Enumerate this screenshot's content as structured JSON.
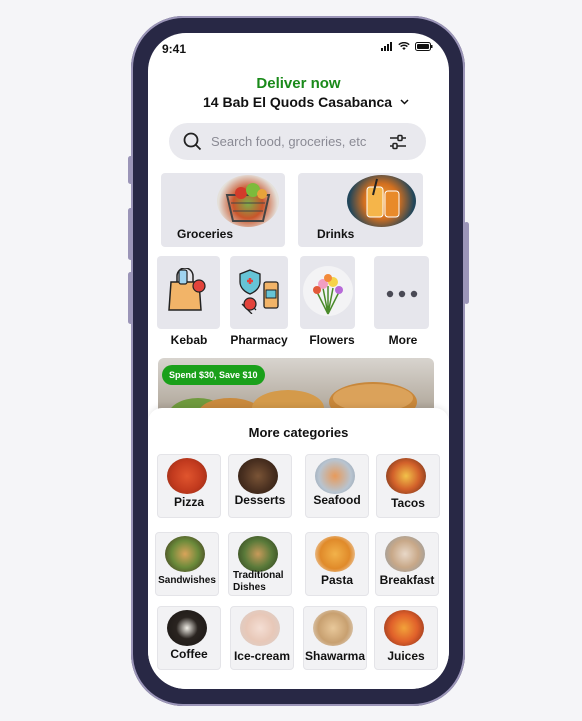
{
  "status": {
    "time": "9:41"
  },
  "header": {
    "deliver_label": "Deliver now",
    "address": "14 Bab El Quods Casabanca"
  },
  "search": {
    "placeholder": "Search food, groceries, etc"
  },
  "featured": [
    {
      "label": "Groceries",
      "icon": "grocery-basket"
    },
    {
      "label": "Drinks",
      "icon": "drinks"
    }
  ],
  "shortcuts": [
    {
      "label": "Kebab",
      "icon": "shopping-bag-icon"
    },
    {
      "label": "Pharmacy",
      "icon": "pharmacy-icon"
    },
    {
      "label": "Flowers",
      "icon": "flowers-icon"
    },
    {
      "label": "More",
      "icon": "more-dots-icon"
    }
  ],
  "promo": {
    "badge": "Spend $30, Save $10"
  },
  "more_categories": {
    "title": "More categories",
    "items": [
      {
        "label": "Pizza"
      },
      {
        "label": "Desserts"
      },
      {
        "label": "Seafood"
      },
      {
        "label": "Tacos"
      },
      {
        "label": "Sandwishes"
      },
      {
        "label": "Traditional Dishes"
      },
      {
        "label": "Pasta"
      },
      {
        "label": "Breakfast"
      },
      {
        "label": "Coffee"
      },
      {
        "label": "Ice-cream"
      },
      {
        "label": "Shawarma"
      },
      {
        "label": "Juices"
      }
    ]
  },
  "colors": {
    "accent_green": "#1a8a1a",
    "badge_green": "#1aa01a",
    "frame": "#282845"
  }
}
